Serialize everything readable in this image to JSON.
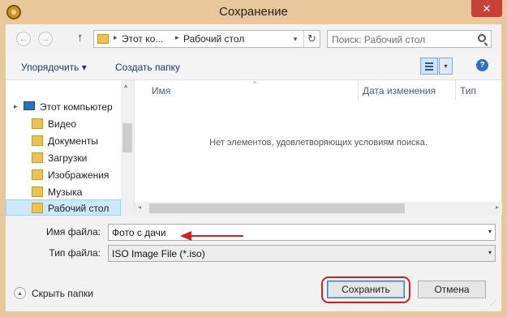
{
  "window": {
    "title": "Сохранение",
    "close_symbol": "✕"
  },
  "address_bar": {
    "back_symbol": "←",
    "forward_symbol": "→",
    "up_symbol": "↑",
    "sep_symbol": "▸",
    "crumbs": [
      "Этот ко...",
      "Рабочий стол"
    ],
    "dropdown_symbol": "▾",
    "refresh_symbol": "↻",
    "search_placeholder": "Поиск: Рабочий стол"
  },
  "toolbar": {
    "organize_label": "Упорядочить ▾",
    "new_folder_label": "Создать папку",
    "view_dropdown_symbol": "▾",
    "help_symbol": "?"
  },
  "nav_pane": {
    "items": [
      {
        "label": "Этот компьютер",
        "icon": "computer-icon"
      },
      {
        "label": "Видео",
        "icon": "folder-icon"
      },
      {
        "label": "Документы",
        "icon": "folder-icon"
      },
      {
        "label": "Загрузки",
        "icon": "folder-icon"
      },
      {
        "label": "Изображения",
        "icon": "folder-icon"
      },
      {
        "label": "Музыка",
        "icon": "folder-icon"
      },
      {
        "label": "Рабочий стол",
        "icon": "folder-icon",
        "selected": true
      }
    ],
    "expand_symbol": "▸",
    "scroll_up_symbol": "▴"
  },
  "file_pane": {
    "columns": [
      "Имя",
      "Дата изменения",
      "Тип"
    ],
    "sort_symbol": "^",
    "empty_message": "Нет элементов, удовлетворяющих условиям поиска.",
    "scroll_left_symbol": "◂",
    "scroll_right_symbol": "▸"
  },
  "form": {
    "filename_label": "Имя файла:",
    "filename_value": "Фото с дачи",
    "filetype_label": "Тип файла:",
    "filetype_value": "ISO Image File (*.iso)",
    "dropdown_symbol": "▾"
  },
  "footer": {
    "hide_folders_label": "Скрыть папки",
    "hide_symbol": "▴",
    "save_label": "Сохранить",
    "cancel_label": "Отмена",
    "grip_symbol": "⋰"
  },
  "colors": {
    "accent": "#d51f1f",
    "selection": "#cde8ff",
    "frame": "#e9c79c"
  }
}
